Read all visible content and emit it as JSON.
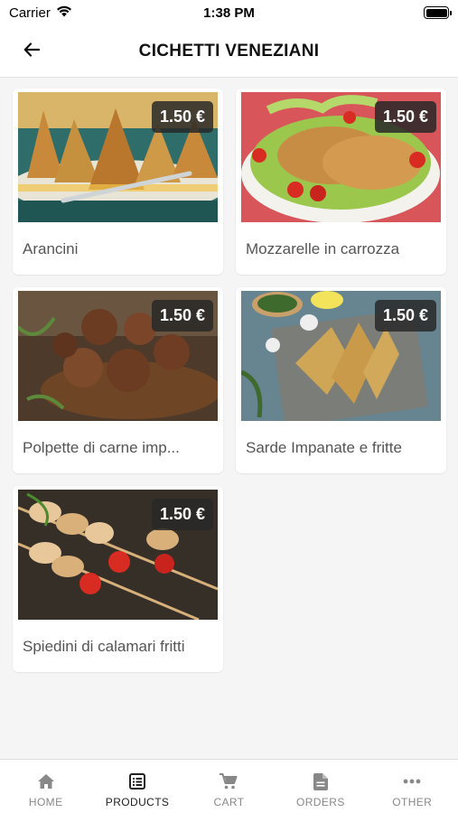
{
  "status_bar": {
    "carrier": "Carrier",
    "time": "1:38 PM"
  },
  "header": {
    "title": "CICHETTI VENEZIANI",
    "back_icon": "arrow-left-icon"
  },
  "products": [
    {
      "name": "Arancini",
      "price": "1.50 €"
    },
    {
      "name": "Mozzarelle in carrozza",
      "price": "1.50 €"
    },
    {
      "name": "Polpette di carne imp...",
      "price": "1.50 €"
    },
    {
      "name": "Sarde Impanate e fritte",
      "price": "1.50 €"
    },
    {
      "name": "Spiedini di calamari fritti",
      "price": "1.50 €"
    }
  ],
  "tabs": [
    {
      "label": "HOME",
      "icon": "home-icon"
    },
    {
      "label": "PRODUCTS",
      "icon": "products-list-icon",
      "active": true
    },
    {
      "label": "CART",
      "icon": "cart-icon"
    },
    {
      "label": "ORDERS",
      "icon": "orders-document-icon"
    },
    {
      "label": "OTHER",
      "icon": "more-dots-icon"
    }
  ],
  "colors": {
    "active_tab": "#222222",
    "inactive_tab": "#888888",
    "badge_bg": "#2b2b2b"
  }
}
